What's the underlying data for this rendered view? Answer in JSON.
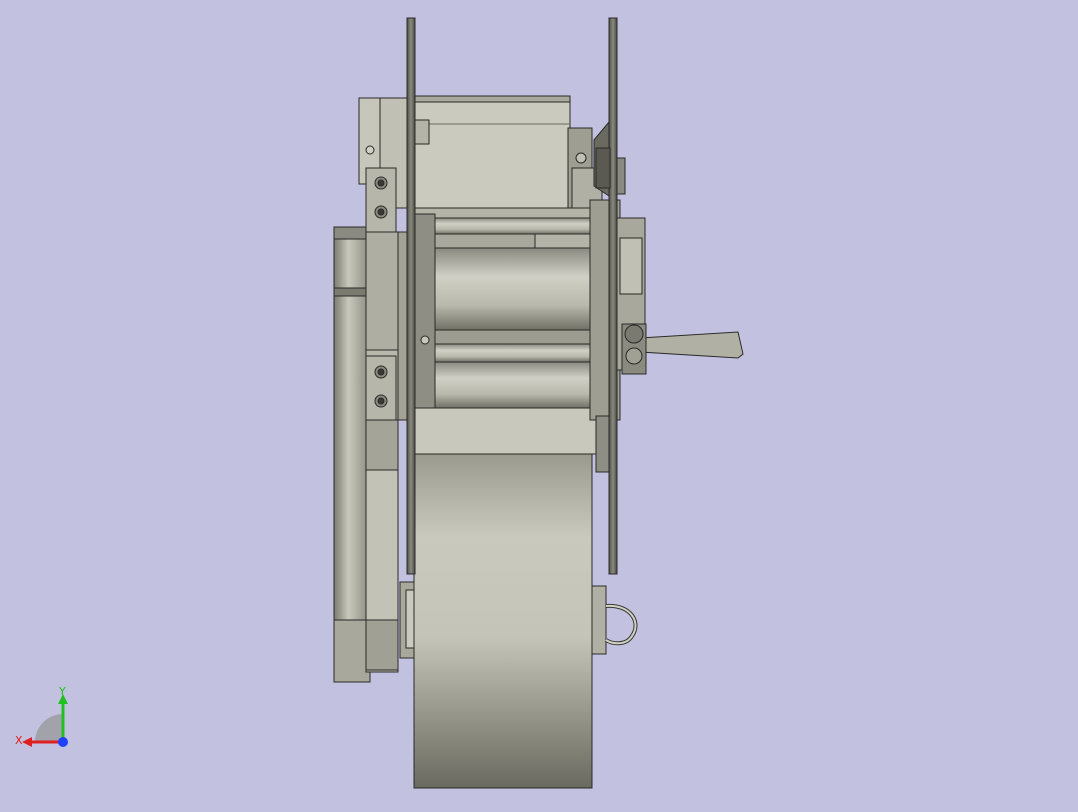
{
  "viewport": {
    "background": "#c2c2e0",
    "model": "roller-feed-assembly-side-view"
  },
  "triad": {
    "x_label": "X",
    "y_label": "Y",
    "x_color": "#e02020",
    "y_color": "#20c020",
    "z_color": "#2040ff",
    "icon": "coordinate-triad-icon"
  },
  "colors": {
    "part_light": "#c8c8bc",
    "part_mid": "#9c9c90",
    "part_dark": "#6a6a60",
    "edge": "#2a2a28"
  }
}
